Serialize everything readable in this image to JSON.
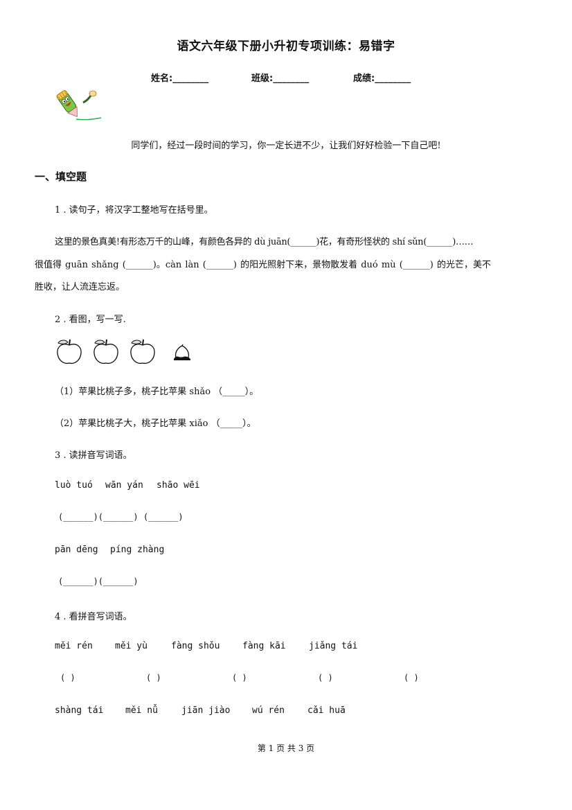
{
  "title": "语文六年级下册小升初专项训练：易错字",
  "info": {
    "name_label": "姓名:________",
    "class_label": "班级:________",
    "score_label": "成绩:________"
  },
  "greeting": "同学们，经过一段时间的学习，你一定长进不少，让我们好好检验一下自己吧!",
  "section1": "一、填空题",
  "q1": {
    "prompt": "1 . 读句子，将汉字工整地写在括号里。",
    "line1": "这里的景色真美!有形态万千的山峰，有颜色各异的 dù juān(______)花，有奇形怪状的 shí sǔn(______)……",
    "line2": "很值得 guān shǎng (______)。càn làn (______) 的阳光照射下来，景物散发着 duó mù (______) 的光芒，美不",
    "line3": "胜收，让人流连忘返。"
  },
  "q2": {
    "prompt": "2 . 看图，写一写.",
    "images": [
      "apple-icon",
      "apple-icon",
      "apple-icon",
      "peach-icon"
    ],
    "item1": "（1）苹果比桃子多，桃子比苹果 shǎo （_____）。",
    "item2": "（2）苹果比桃子大，桃子比苹果 xiǎo （_____）。"
  },
  "q3": {
    "prompt": "3 . 读拼音写词语。",
    "row1_pinyin": [
      "luò tuó",
      "wān yán",
      "shāo wēi"
    ],
    "row1_blanks": "(______)(______)   (______)",
    "row2_pinyin": [
      "pān dēng",
      "píng zhàng"
    ],
    "row2_blanks": "(______)(______)"
  },
  "q4": {
    "prompt": "4 . 看拼音写词语。",
    "row1_pinyin": [
      "měi rén",
      "měi yù",
      "fàng shǒu",
      "fàng kāi",
      "jiǎng tái"
    ],
    "row1_blanks": [
      "(    )",
      "(    )",
      "(    )",
      "(    )",
      "(    )"
    ],
    "row2_pinyin": [
      "shàng tái",
      "měi nǚ",
      "jiān jiào",
      "wú rén",
      "cǎi huā"
    ]
  },
  "footer": "第 1 页 共 3 页"
}
